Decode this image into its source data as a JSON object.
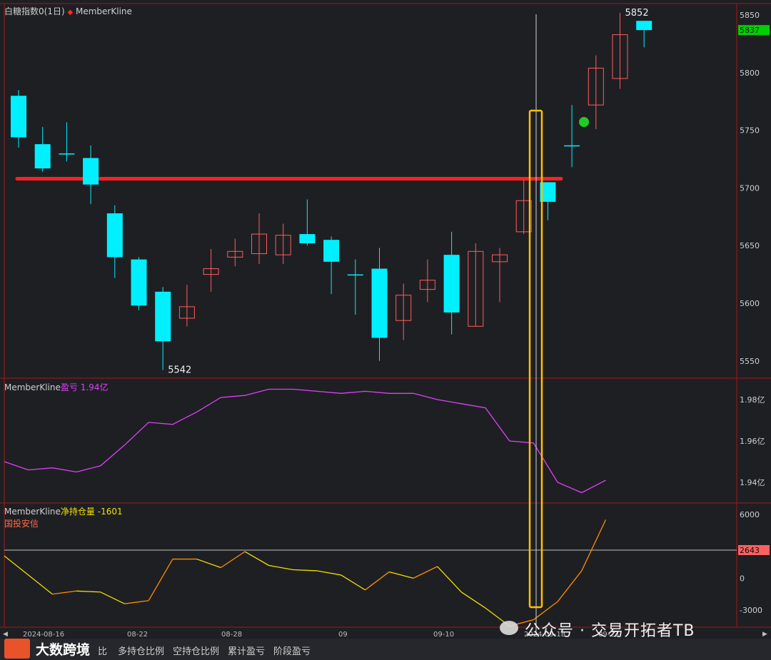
{
  "header": {
    "symbol_label": "白糖指数0(1日)",
    "marker_glyph": "◆",
    "indicator_name": "MemberKline"
  },
  "price_panel": {
    "low_label": "5542",
    "high_label": "5852",
    "current_price_badge": "5837",
    "resistance_level": 5708
  },
  "pnl_panel": {
    "title": "MemberKline",
    "metric_label": "盈亏",
    "metric_value": "1.94亿",
    "axis_ticks": [
      "1.98亿",
      "1.96亿",
      "1.94亿"
    ]
  },
  "position_panel": {
    "title": "MemberKline",
    "metric_label": "净持仓量",
    "metric_value": "-1601",
    "member_name": "国投安信",
    "axis_ticks": [
      "6000",
      "0",
      "-3000"
    ],
    "current_badge": "2643",
    "ref_line_value": 2643
  },
  "x_axis": {
    "tick_labels": [
      "2024-08-16",
      "08-22",
      "08-28",
      "09",
      "09-10",
      "2024-09-18",
      "09-23"
    ]
  },
  "bottom_tabs": [
    "比",
    "多持仓比例",
    "空持仓比例",
    "累计盈亏",
    "阶段盈亏"
  ],
  "watermark": {
    "brand": "大数跨境",
    "wechat_text": "公众号 · 交易开拓者TB"
  },
  "colors": {
    "background": "#1e1f23",
    "bull_candle": "#ff5c5c",
    "bear_candle": "#00f0ff",
    "resistance_line": "#ff2020",
    "pnl_line": "#e040fb",
    "position_line_low": "#f0e000",
    "position_line_high": "#ff8c00",
    "highlight_box": "#ffc000",
    "badge_green": "#00d000",
    "badge_red": "#ff6060"
  },
  "chart_data": [
    {
      "type": "candlestick",
      "title": "白糖指数0(1日)",
      "ylim": [
        5535,
        5860
      ],
      "y_ticks": [
        5850,
        5800,
        5750,
        5700,
        5650,
        5600,
        5550
      ],
      "candles": [
        {
          "o": 5780,
          "h": 5785,
          "l": 5735,
          "c": 5744
        },
        {
          "o": 5738,
          "h": 5753,
          "l": 5714,
          "c": 5717
        },
        {
          "o": 5730,
          "h": 5757,
          "l": 5723,
          "c": 5730
        },
        {
          "o": 5726,
          "h": 5737,
          "l": 5686,
          "c": 5703
        },
        {
          "o": 5678,
          "h": 5685,
          "l": 5622,
          "c": 5640
        },
        {
          "o": 5638,
          "h": 5640,
          "l": 5594,
          "c": 5598
        },
        {
          "o": 5610,
          "h": 5614,
          "l": 5542,
          "c": 5567
        },
        {
          "o": 5587,
          "h": 5616,
          "l": 5580,
          "c": 5597
        },
        {
          "o": 5625,
          "h": 5647,
          "l": 5610,
          "c": 5630
        },
        {
          "o": 5640,
          "h": 5656,
          "l": 5632,
          "c": 5645
        },
        {
          "o": 5643,
          "h": 5678,
          "l": 5634,
          "c": 5660
        },
        {
          "o": 5642,
          "h": 5669,
          "l": 5634,
          "c": 5659
        },
        {
          "o": 5660,
          "h": 5690,
          "l": 5650,
          "c": 5652
        },
        {
          "o": 5655,
          "h": 5658,
          "l": 5608,
          "c": 5636
        },
        {
          "o": 5625,
          "h": 5638,
          "l": 5590,
          "c": 5625
        },
        {
          "o": 5630,
          "h": 5648,
          "l": 5550,
          "c": 5570
        },
        {
          "o": 5585,
          "h": 5617,
          "l": 5568,
          "c": 5607
        },
        {
          "o": 5612,
          "h": 5638,
          "l": 5601,
          "c": 5620
        },
        {
          "o": 5642,
          "h": 5662,
          "l": 5573,
          "c": 5592
        },
        {
          "o": 5580,
          "h": 5652,
          "l": 5580,
          "c": 5645
        },
        {
          "o": 5636,
          "h": 5648,
          "l": 5601,
          "c": 5642
        },
        {
          "o": 5662,
          "h": 5707,
          "l": 5660,
          "c": 5689
        },
        {
          "o": 5705,
          "h": 5705,
          "l": 5672,
          "c": 5688
        },
        {
          "o": 5737,
          "h": 5772,
          "l": 5718,
          "c": 5737
        },
        {
          "o": 5772,
          "h": 5815,
          "l": 5751,
          "c": 5804
        },
        {
          "o": 5795,
          "h": 5852,
          "l": 5786,
          "c": 5833
        },
        {
          "o": 5845,
          "h": 5845,
          "l": 5822,
          "c": 5837
        }
      ]
    },
    {
      "type": "line",
      "title": "MemberKline 盈亏",
      "unit": "亿",
      "ylim": [
        1.93,
        1.99
      ],
      "values": [
        1.95,
        1.946,
        1.947,
        1.945,
        1.948,
        1.958,
        1.969,
        1.968,
        1.974,
        1.981,
        1.982,
        1.985,
        1.985,
        1.984,
        1.983,
        1.984,
        1.983,
        1.983,
        1.98,
        1.978,
        1.976,
        1.96,
        1.959,
        1.94,
        1.935,
        1.941
      ]
    },
    {
      "type": "line",
      "title": "MemberKline 净持仓量",
      "member": "国投安信",
      "ylim": [
        -4600,
        7000
      ],
      "y_ticks": [
        6000,
        0,
        -3000
      ],
      "values": [
        2100,
        300,
        -1500,
        -1200,
        -1300,
        -2400,
        -2100,
        1800,
        1800,
        1000,
        2500,
        1200,
        800,
        700,
        300,
        -1100,
        600,
        0,
        1100,
        -1300,
        -2800,
        -4500,
        -3900,
        -2200,
        700,
        5500
      ]
    }
  ]
}
